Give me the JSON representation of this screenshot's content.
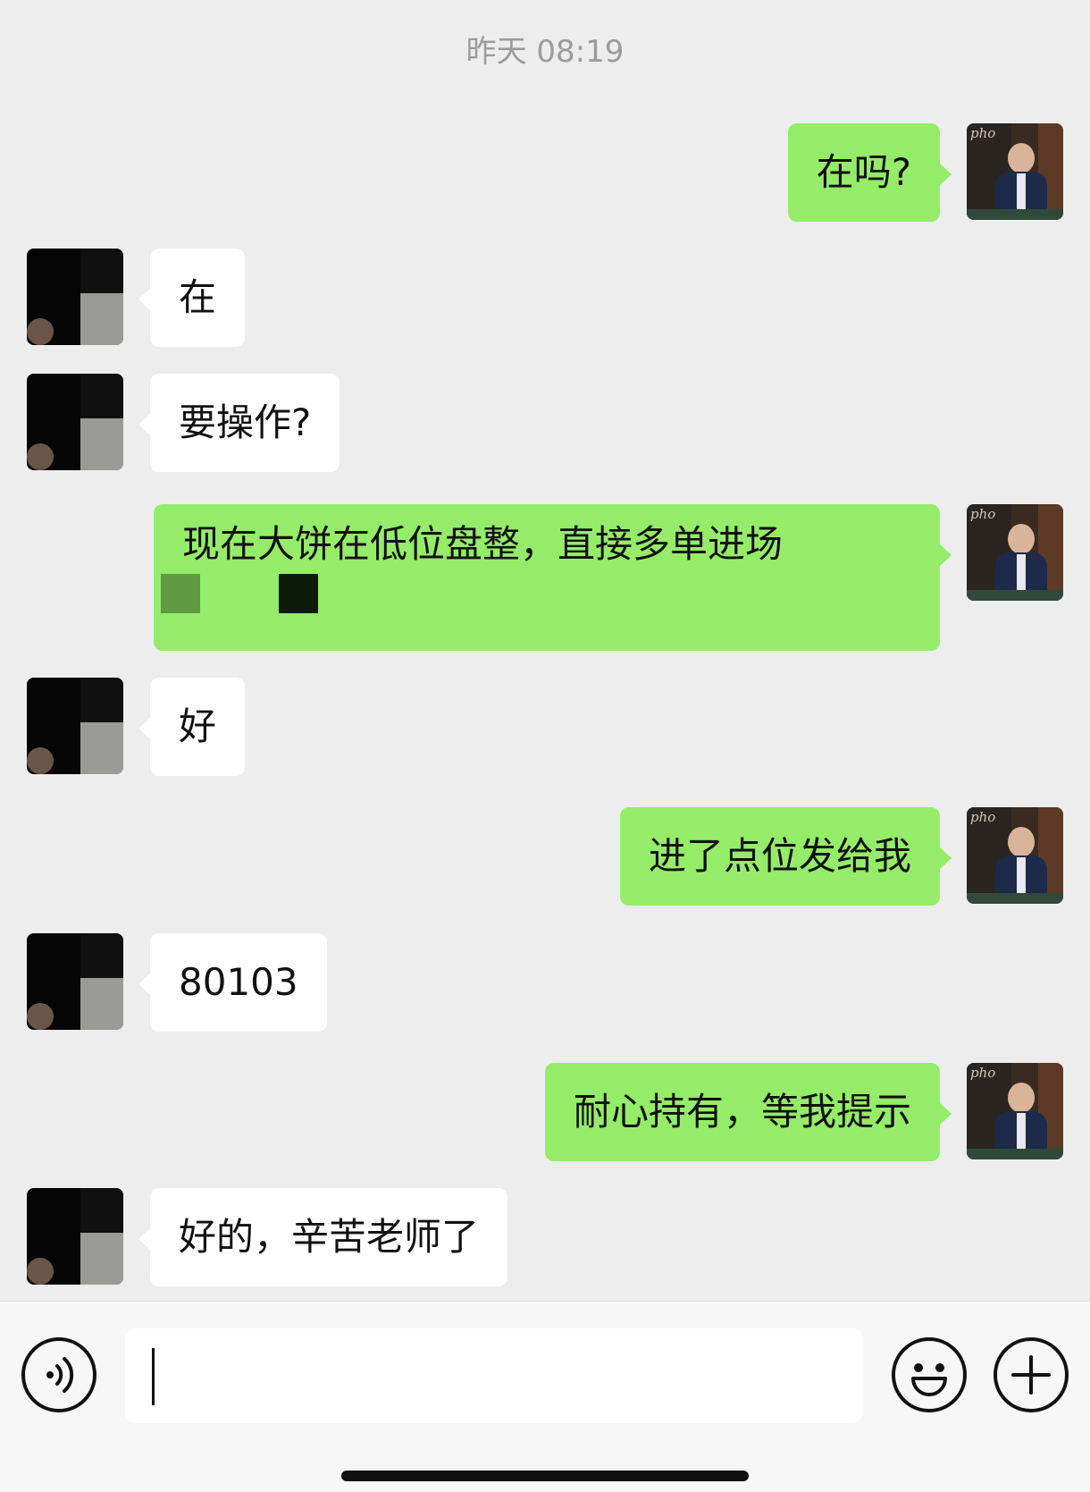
{
  "timestamp": "昨天 08:19",
  "messages": [
    {
      "from": "self",
      "text": "在吗?"
    },
    {
      "from": "other",
      "text": "在"
    },
    {
      "from": "other",
      "text": "要操作?"
    },
    {
      "from": "self",
      "text": "现在大饼在低位盘整，直接多单进场"
    },
    {
      "from": "other",
      "text": "好"
    },
    {
      "from": "self",
      "text": "进了点位发给我"
    },
    {
      "from": "other",
      "text": "80103"
    },
    {
      "from": "self",
      "text": "耐心持有，等我提示"
    },
    {
      "from": "other",
      "text": "好的，辛苦老师了"
    }
  ],
  "avatar_watermark": "pho",
  "input": {
    "value": ""
  },
  "colors": {
    "outgoing_bubble": "#95ec69",
    "incoming_bubble": "#ffffff",
    "background": "#ededed"
  },
  "icons": [
    "voice-icon",
    "emoji-icon",
    "plus-icon"
  ]
}
